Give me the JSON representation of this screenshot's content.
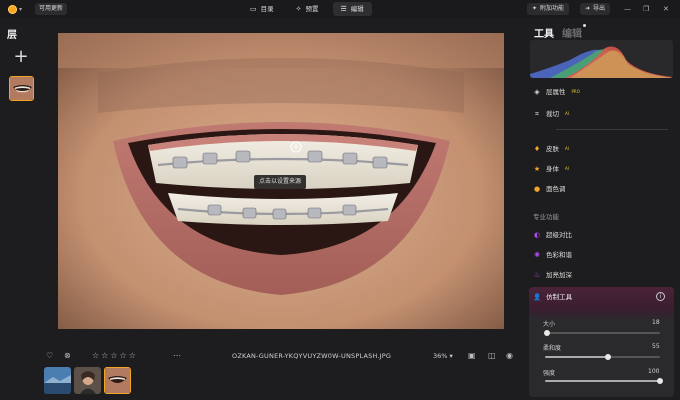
{
  "topbar": {
    "update_label": "可用更新",
    "tabs": [
      {
        "label": "目录",
        "icon": "catalog-icon"
      },
      {
        "label": "预置",
        "icon": "presets-icon"
      },
      {
        "label": "编辑",
        "icon": "edit-icon"
      }
    ],
    "active_tab": "编辑",
    "extras_label": "附加功能",
    "export_label": "导出"
  },
  "layers": {
    "title": "层"
  },
  "canvas": {
    "tooltip": "点击以设置来源"
  },
  "bottombar": {
    "filename": "OZKAN-GUNER-YKQYVUYZW0W-UNSPLASH.JPG",
    "zoom": "36%",
    "rating_stars": 5
  },
  "panel": {
    "tab_tools": "工具",
    "tab_edit": "编辑",
    "items": [
      {
        "label": "层属性",
        "icon": "layers-props-icon",
        "badge": "PRO"
      },
      {
        "label": "裁切",
        "icon": "crop-icon",
        "badge": "AI"
      },
      {
        "label": "皮肤",
        "icon": "skin-icon",
        "badge": "AI",
        "color": "#f0a526"
      },
      {
        "label": "身体",
        "icon": "body-icon",
        "badge": "AI",
        "color": "#f0a526"
      },
      {
        "label": "面色调",
        "icon": "face-tone-icon",
        "color": "#f0a526"
      }
    ],
    "section_pro": "专业功能",
    "pro_items": [
      {
        "label": "超级对比",
        "icon": "contrast-icon",
        "color": "#b14cf5"
      },
      {
        "label": "色彩和谐",
        "icon": "harmony-icon",
        "color": "#b14cf5"
      },
      {
        "label": "加亮加深",
        "icon": "dodge-burn-icon",
        "color": "#b14cf5"
      }
    ],
    "heal": {
      "title": "仿制工具",
      "sliders": [
        {
          "label": "大小",
          "value": "18",
          "fraction": 0.02
        },
        {
          "label": "柔和度",
          "value": "55",
          "fraction": 0.55
        },
        {
          "label": "强度",
          "value": "100",
          "fraction": 1.0
        }
      ]
    }
  }
}
